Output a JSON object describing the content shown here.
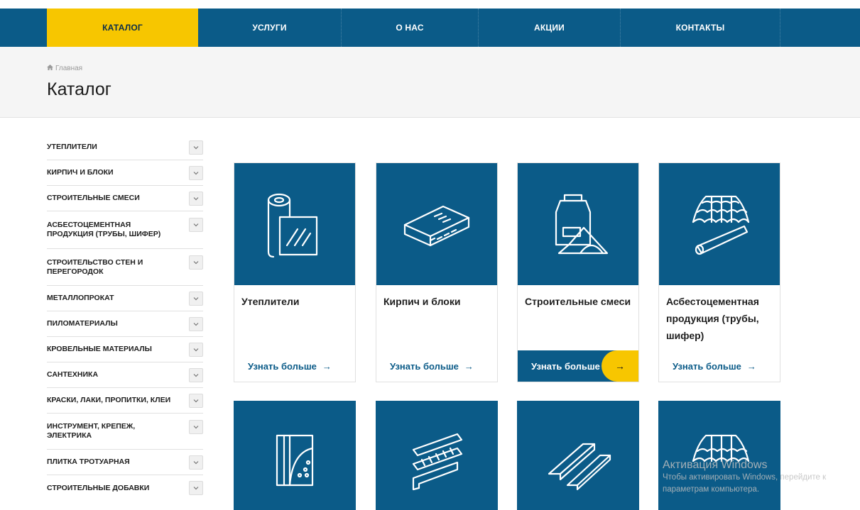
{
  "nav": {
    "items": [
      {
        "label": "КАТАЛОГ"
      },
      {
        "label": "УСЛУГИ"
      },
      {
        "label": "О НАС"
      },
      {
        "label": "АКЦИИ"
      },
      {
        "label": "КОНТАКТЫ"
      }
    ]
  },
  "breadcrumb": {
    "home": "Главная"
  },
  "page": {
    "title": "Каталог"
  },
  "sidebar": {
    "items": [
      {
        "label": "УТЕПЛИТЕЛИ"
      },
      {
        "label": "КИРПИЧ И БЛОКИ"
      },
      {
        "label": "СТРОИТЕЛЬНЫЕ СМЕСИ"
      },
      {
        "label": "АСБЕСТОЦЕМЕНТНАЯ ПРОДУКЦИЯ (ТРУБЫ, ШИФЕР)"
      },
      {
        "label": "СТРОИТЕЛЬСТВО СТЕН И ПЕРЕГОРОДОК"
      },
      {
        "label": "МЕТАЛЛОПРОКАТ"
      },
      {
        "label": "ПИЛОМАТЕРИАЛЫ"
      },
      {
        "label": "КРОВЕЛЬНЫЕ МАТЕРИАЛЫ"
      },
      {
        "label": "САНТЕХНИКА"
      },
      {
        "label": "КРАСКИ, ЛАКИ, ПРОПИТКИ, КЛЕИ"
      },
      {
        "label": "ИНСТРУМЕНТ, КРЕПЕЖ, ЭЛЕКТРИКА"
      },
      {
        "label": "ПЛИТКА ТРОТУАРНАЯ"
      },
      {
        "label": "СТРОИТЕЛЬНЫЕ ДОБАВКИ"
      }
    ]
  },
  "cards": [
    {
      "title": "Утеплители",
      "more": "Узнать больше",
      "icon": "insulation-roll-icon"
    },
    {
      "title": "Кирпич и блоки",
      "more": "Узнать больше",
      "icon": "brick-icon"
    },
    {
      "title": "Строительные смеси",
      "more": "Узнать больше",
      "icon": "mix-bag-icon"
    },
    {
      "title": "Асбестоцементная продукция (трубы, шифер)",
      "more": "Узнать больше",
      "icon": "slate-pipe-icon"
    }
  ],
  "cards_row2": [
    {
      "icon": "wall-panel-icon"
    },
    {
      "icon": "metal-profile-icon"
    },
    {
      "icon": "lumber-icon"
    },
    {
      "icon": "roof-tile-icon"
    }
  ],
  "arrow": "→",
  "watermark": {
    "line1": "Активация Windows",
    "line2": "Чтобы активировать Windows, перейдите к параметрам компьютера."
  },
  "colors": {
    "primary": "#0b5b88",
    "accent": "#f7c600"
  }
}
